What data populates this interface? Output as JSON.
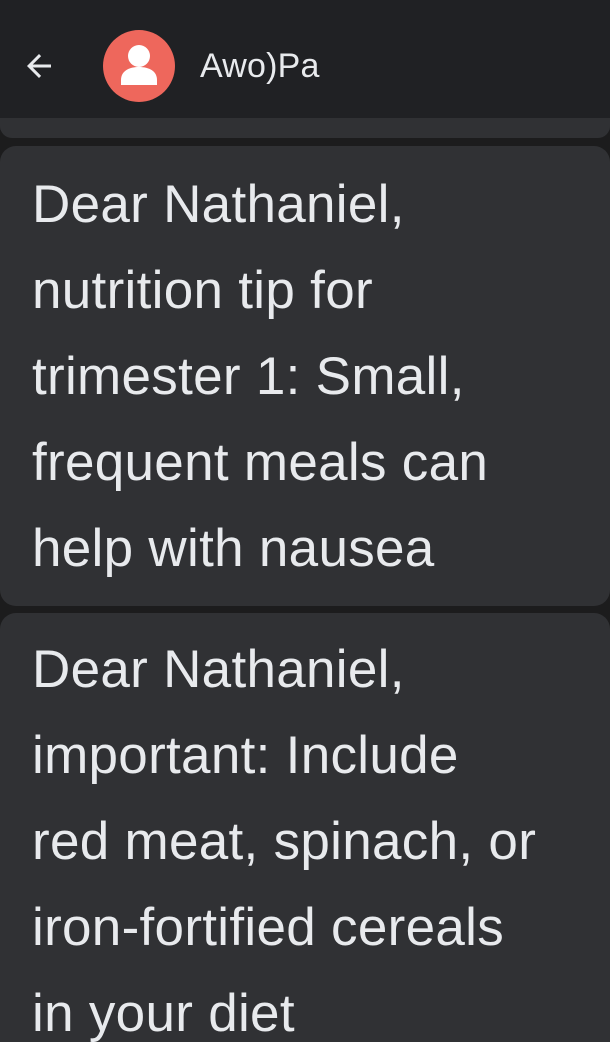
{
  "header": {
    "contact_name": "Awo)Pa",
    "back_icon": "arrow-left-icon",
    "avatar_icon": "person-icon",
    "avatar_color": "#ee675c"
  },
  "messages": [
    {
      "lines": [
        "Dear Nathaniel,",
        "nutrition tip for",
        "trimester 1: Small,",
        "frequent meals can",
        "help with nausea"
      ]
    },
    {
      "lines": [
        "Dear Nathaniel,",
        "important: Include",
        "red meat, spinach, or",
        "iron-fortified cereals",
        "in your diet"
      ]
    }
  ],
  "colors": {
    "background": "#1c1c1d",
    "header_background": "#202124",
    "bubble_background": "#303134",
    "text": "#e8eaed"
  }
}
